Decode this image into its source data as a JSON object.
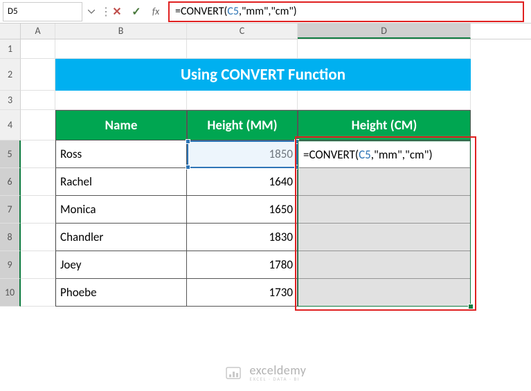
{
  "namebox": "D5",
  "formula_bar": "=CONVERT(C5,\"mm\",\"cm\")",
  "formula_parts": {
    "prefix": "=CONVERT(",
    "ref": "C5",
    "sep1": ",",
    "str1": "\"mm\"",
    "sep2": ",",
    "str2": "\"cm\"",
    "suffix": ")"
  },
  "columns": [
    "A",
    "B",
    "C",
    "D"
  ],
  "rows": [
    "1",
    "2",
    "3",
    "4",
    "5",
    "6",
    "7",
    "8",
    "9",
    "10"
  ],
  "title": "Using CONVERT Function",
  "headers": {
    "name": "Name",
    "height_mm": "Height (MM)",
    "height_cm": "Height (CM)"
  },
  "data": [
    {
      "name": "Ross",
      "mm": "1850"
    },
    {
      "name": "Rachel",
      "mm": "1640"
    },
    {
      "name": "Monica",
      "mm": "1650"
    },
    {
      "name": "Chandler",
      "mm": "1830"
    },
    {
      "name": "Joey",
      "mm": "1780"
    },
    {
      "name": "Phoebe",
      "mm": "1730"
    }
  ],
  "active_cell_display": "=CONVERT(C5,\"mm\",\"cm\")",
  "watermark": {
    "title": "exceldemy",
    "subtitle": "EXCEL · DATA · BI"
  },
  "chart_data": {
    "type": "table",
    "title": "Using CONVERT Function",
    "columns": [
      "Name",
      "Height (MM)",
      "Height (CM)"
    ],
    "rows": [
      [
        "Ross",
        1850,
        "=CONVERT(C5,\"mm\",\"cm\")"
      ],
      [
        "Rachel",
        1640,
        ""
      ],
      [
        "Monica",
        1650,
        ""
      ],
      [
        "Chandler",
        1830,
        ""
      ],
      [
        "Joey",
        1780,
        ""
      ],
      [
        "Phoebe",
        1730,
        ""
      ]
    ]
  }
}
